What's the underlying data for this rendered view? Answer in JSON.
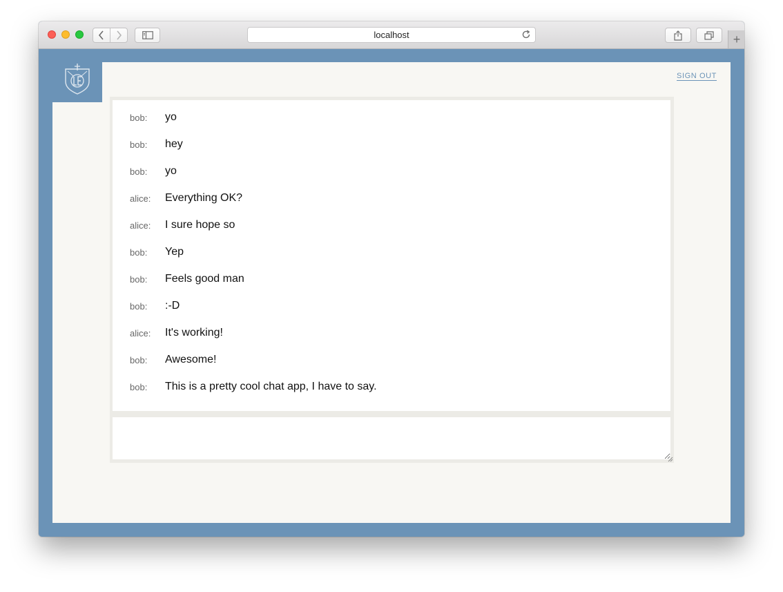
{
  "browser": {
    "address_text": "localhost",
    "icons": [
      "back-arrow-icon",
      "forward-arrow-icon",
      "sidebar-icon",
      "reload-icon",
      "share-icon",
      "tabs-icon",
      "plus-icon"
    ],
    "new_tab_glyph": "+"
  },
  "app": {
    "logo": "shield-logo",
    "sign_out_label": "SIGN OUT",
    "colors": {
      "frame": "#6b93b7",
      "panel": "#f8f7f3",
      "link": "#6b93b7"
    }
  },
  "chat": {
    "messages": [
      {
        "user": "bob:",
        "text": "yo"
      },
      {
        "user": "bob:",
        "text": "hey"
      },
      {
        "user": "bob:",
        "text": "yo"
      },
      {
        "user": "alice:",
        "text": "Everything OK?"
      },
      {
        "user": "alice:",
        "text": "I sure hope so"
      },
      {
        "user": "bob:",
        "text": "Yep"
      },
      {
        "user": "bob:",
        "text": "Feels good man"
      },
      {
        "user": "bob:",
        "text": ":-D"
      },
      {
        "user": "alice:",
        "text": "It's working!"
      },
      {
        "user": "bob:",
        "text": "Awesome!"
      },
      {
        "user": "bob:",
        "text": "This is a pretty cool chat app, I have to say."
      }
    ],
    "compose_value": ""
  }
}
